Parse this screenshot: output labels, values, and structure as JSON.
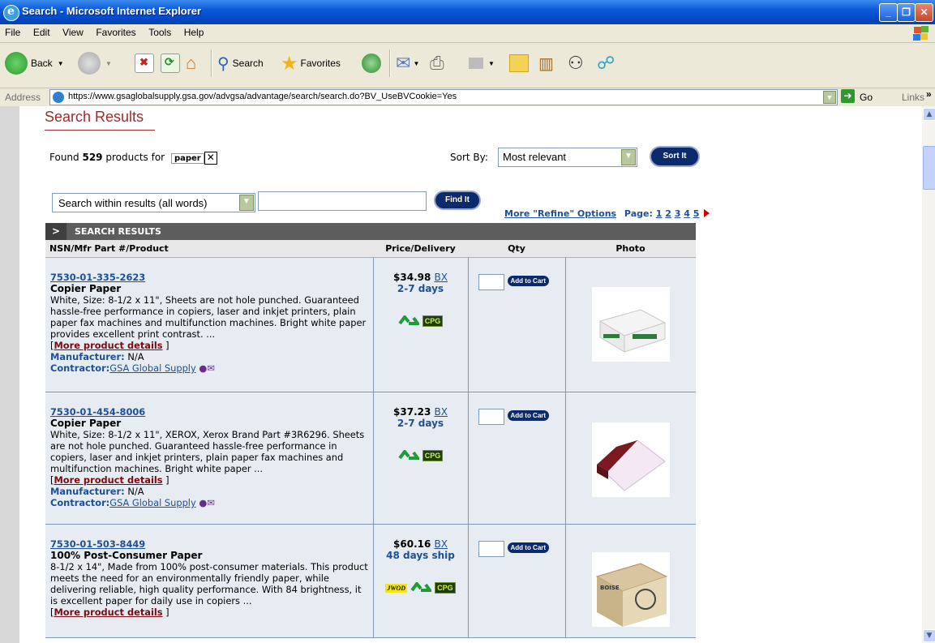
{
  "window": {
    "title": "Search - Microsoft Internet Explorer"
  },
  "menu": [
    "File",
    "Edit",
    "View",
    "Favorites",
    "Tools",
    "Help"
  ],
  "toolbar": {
    "back": "Back",
    "search": "Search",
    "favorites": "Favorites"
  },
  "address": {
    "label": "Address",
    "url": "https://www.gsaglobalsupply.gsa.gov/advgsa/advantage/search/search.do?BV_UseBVCookie=Yes",
    "go": "Go",
    "links": "Links"
  },
  "page": {
    "heading": "Search Results",
    "found_prefix": "Found",
    "found_count": "529",
    "found_mid": "products for",
    "query": "paper",
    "sort_label": "Sort By:",
    "sort_value": "Most relevant",
    "sort_button": "Sort It",
    "within_value": "Search within results (all words)",
    "find_button": "Find It",
    "refine": "More \"Refine\" Options",
    "page_label": "Page:",
    "pages": [
      "1",
      "2",
      "3",
      "4",
      "5"
    ]
  },
  "results": {
    "bar_title": "SEARCH RESULTS",
    "columns": [
      "NSN/Mfr Part #/Product",
      "Price/Delivery",
      "Qty",
      "Photo"
    ],
    "add_to_cart": "Add to Cart",
    "more_details": "More product details",
    "manufacturer_label": "Manufacturer:",
    "contractor_label": "Contractor:",
    "items": [
      {
        "nsn": "7530-01-335-2623",
        "name": "Copier Paper",
        "desc": "White, Size: 8-1/2 x 11\", Sheets are not hole punched. Guaranteed hassle-free performance in copiers, laser and inkjet printers, plain paper fax machines and multifunction machines. Bright white paper provides excellent print contrast. ...",
        "manufacturer": "N/A",
        "contractor": "GSA Global Supply",
        "price": "$34.98",
        "unit": "BX",
        "delivery": "2-7 days"
      },
      {
        "nsn": "7530-01-454-8006",
        "name": "Copier Paper",
        "desc": "White, Size: 8-1/2 x 11\", XEROX, Xerox Brand Part #3R6296. Sheets are not hole punched. Guaranteed hassle-free performance in copiers, laser and inkjet printers, plain paper fax machines and multifunction machines. Bright white paper ...",
        "manufacturer": "N/A",
        "contractor": "GSA Global Supply",
        "price": "$37.23",
        "unit": "BX",
        "delivery": "2-7 days"
      },
      {
        "nsn": "7530-01-503-8449",
        "name": "100% Post-Consumer Paper",
        "desc": "8-1/2 x 14\", Made from 100% post-consumer materials. This product meets the need for an environmentally friendly paper, while delivering reliable, high quality performance. With 84 brightness, it is excellent paper for daily use in copiers ...",
        "price": "$60.16",
        "unit": "BX",
        "delivery": "48 days ship",
        "badge_jwod": "JWOD"
      }
    ],
    "badge_cpg": "CPG",
    "box_brand": "BOISE"
  }
}
